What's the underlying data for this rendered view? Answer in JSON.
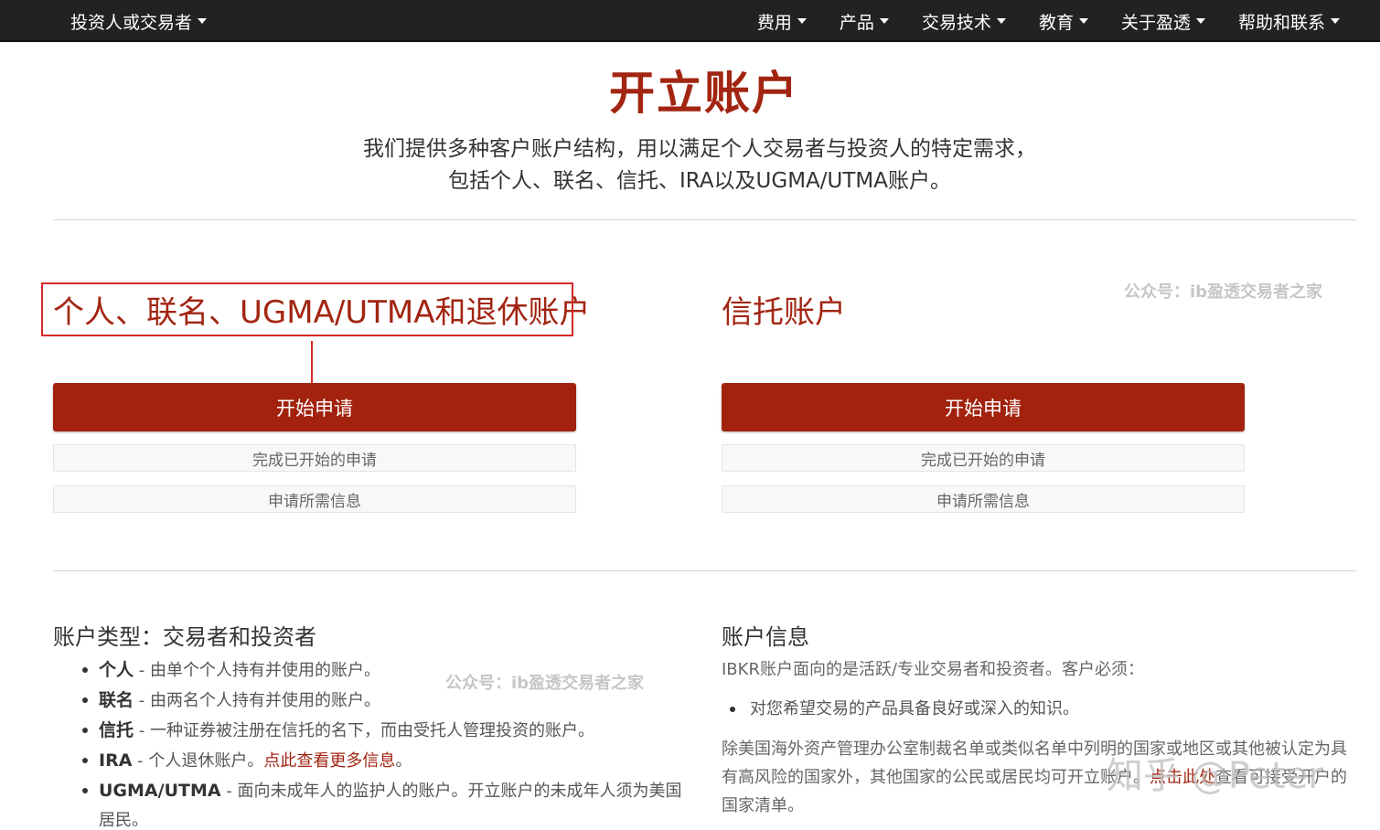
{
  "nav": {
    "left": "投资人或交易者",
    "items": [
      "费用",
      "产品",
      "交易技术",
      "教育",
      "关于盈透",
      "帮助和联系"
    ]
  },
  "hero": {
    "title": "开立账户",
    "intro_line1": "我们提供多种客户账户结构，用以满足个人交易者与投资人的特定需求，",
    "intro_line2": "包括个人、联名、信托、IRA以及UGMA/UTMA账户。"
  },
  "individual": {
    "title": "个人、联名、UGMA/UTMA和退休账户",
    "start": "开始申请",
    "resume": "完成已开始的申请",
    "required": "申请所需信息"
  },
  "trust": {
    "title": "信托账户",
    "start": "开始申请",
    "resume": "完成已开始的申请",
    "required": "申请所需信息"
  },
  "watermarks": {
    "wechat1": "公众号：ib盈透交易者之家",
    "wechat2": "公众号：ib盈透交易者之家",
    "zhihu": "知乎 @Peter"
  },
  "account_types": {
    "title": "账户类型：交易者和投资者",
    "items": [
      {
        "term": "个人",
        "desc": " - 由单个个人持有并使用的账户。"
      },
      {
        "term": "联名",
        "desc": " - 由两名个人持有并使用的账户。"
      },
      {
        "term": "信托",
        "desc": " - 一种证券被注册在信托的名下，而由受托人管理投资的账户。"
      },
      {
        "term": "IRA",
        "desc": " - 个人退休账户。",
        "link": "点此查看更多信息",
        "tail": "。"
      },
      {
        "term": "UGMA/UTMA",
        "desc": " - 面向未成年人的监护人的账户。开立账户的未成年人须为美国居民。"
      }
    ]
  },
  "account_info": {
    "title": "账户信息",
    "intro": "IBKR账户面向的是活跃/专业交易者和投资者。客户必须：",
    "bullet": "对您希望交易的产品具备良好或深入的知识。",
    "para_before": "除美国海外资产管理办公室制裁名单或类似名单中列明的国家或地区或其他被认定为具有高风险的国家外，其他国家的公民或居民均可开立账户。",
    "para_link": "点击此处",
    "para_after": "查看可接受开户的国家清单。"
  }
}
